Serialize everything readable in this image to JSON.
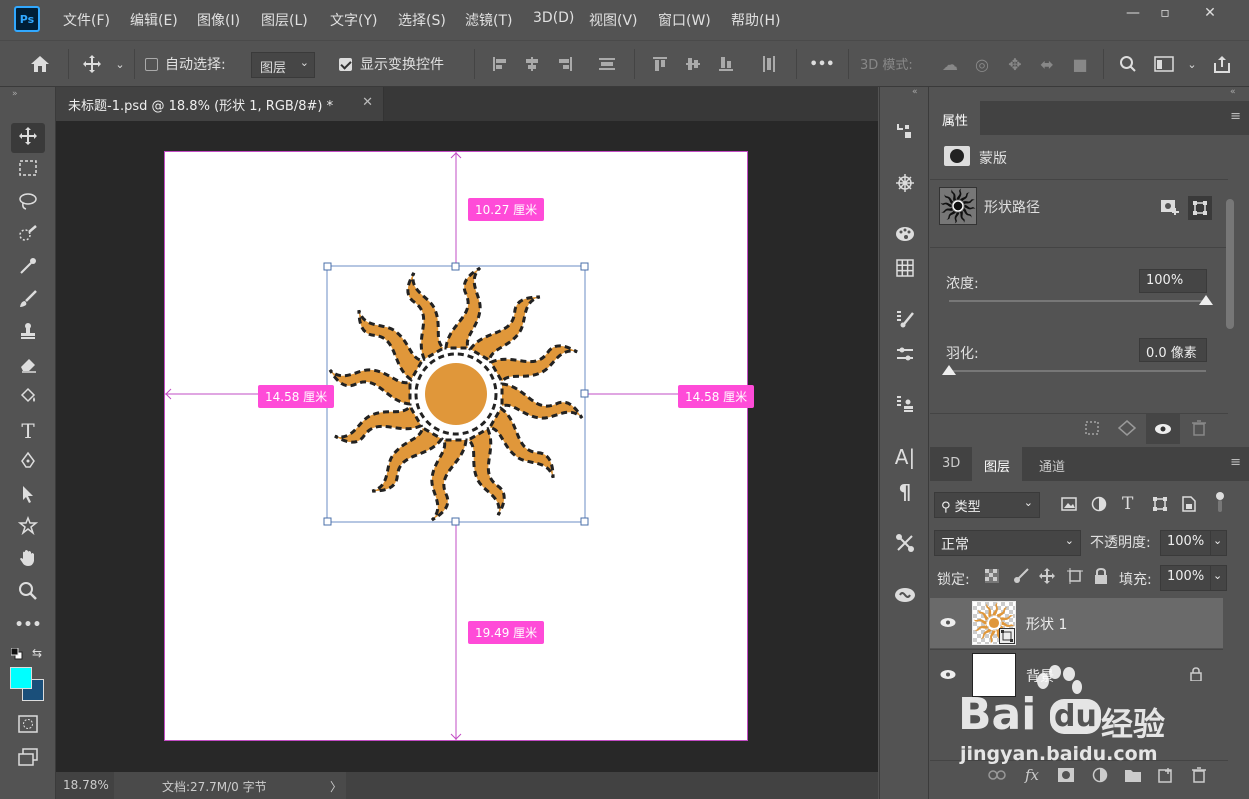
{
  "app": {
    "logo": "Ps"
  },
  "menu": [
    "文件(F)",
    "编辑(E)",
    "图像(I)",
    "图层(L)",
    "文字(Y)",
    "选择(S)",
    "滤镜(T)",
    "3D(D)",
    "视图(V)",
    "窗口(W)",
    "帮助(H)"
  ],
  "window": {
    "minimize": "—",
    "maximize": "▫",
    "close": "✕"
  },
  "options": {
    "auto_select_label": "自动选择:",
    "auto_select_checked": false,
    "auto_select_target": "图层",
    "show_transform_label": "显示变换控件",
    "show_transform_checked": true,
    "more": "•••",
    "mode_3d_label": "3D 模式:"
  },
  "document": {
    "tab_title": "未标题-1.psd @ 18.8% (形状 1, RGB/8#) *",
    "tab_close": "✕",
    "zoom": "18.78%",
    "doc_info": "文档:27.7M/0 字节",
    "status_arrow": "〉"
  },
  "measurements": {
    "top": "10.27 厘米",
    "left": "14.58 厘米",
    "right": "14.58 厘米",
    "bottom": "19.49 厘米"
  },
  "colors": {
    "foreground": "#00ffff",
    "background": "#1a4f7a",
    "measure_pink": "#ff4bd8",
    "shape_orange": "#e0973a"
  },
  "properties": {
    "tab": "属性",
    "mask_label": "蒙版",
    "shape_path_label": "形状路径",
    "density_label": "浓度:",
    "density_value": "100%",
    "density_level": 1.0,
    "feather_label": "羽化:",
    "feather_value": "0.0 像素",
    "feather_level": 0.0
  },
  "layers_panel": {
    "tabs": [
      "3D",
      "图层",
      "通道"
    ],
    "active_tab": "图层",
    "filter_type": "类型",
    "blend_mode": "正常",
    "opacity_label": "不透明度:",
    "opacity_value": "100%",
    "lock_label": "锁定:",
    "fill_label": "填充:",
    "fill_value": "100%",
    "layers": [
      {
        "name": "形状 1",
        "selected": true,
        "locked": false
      },
      {
        "name": "背景",
        "selected": false,
        "locked": true
      }
    ]
  },
  "watermark": {
    "brand": "Bai",
    "brand_mid": "du",
    "brand_suffix": "经验",
    "url": "jingyan.baidu.com"
  }
}
